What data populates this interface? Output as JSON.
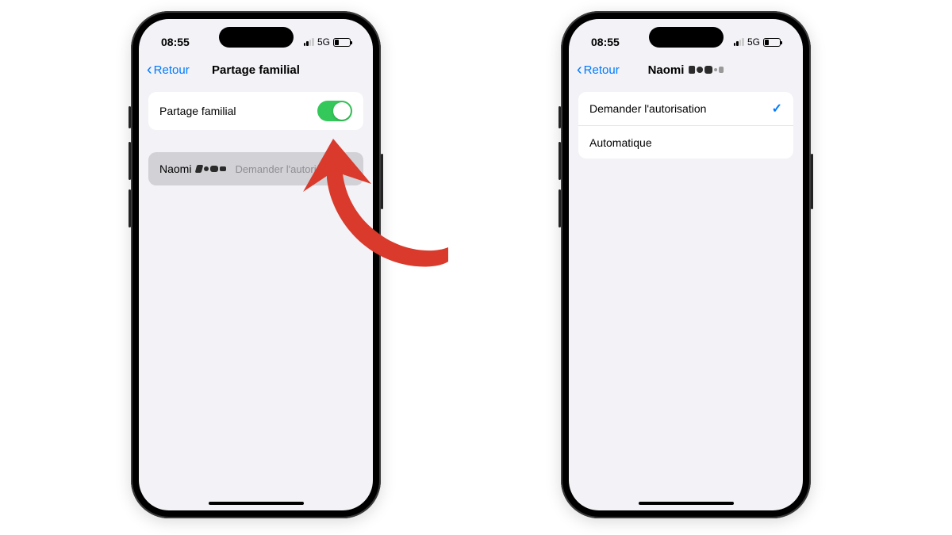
{
  "status": {
    "time": "08:55",
    "network": "5G"
  },
  "colors": {
    "ios_blue": "#007aff",
    "ios_green": "#34c759",
    "arrow_red": "#d93a2b"
  },
  "left_phone": {
    "nav": {
      "back_label": "Retour",
      "title": "Partage familial"
    },
    "toggle_row": {
      "label": "Partage familial",
      "enabled": true
    },
    "member_row": {
      "name": "Naomi",
      "name_obscured": true,
      "detail": "Demander l'autorisation"
    }
  },
  "right_phone": {
    "nav": {
      "back_label": "Retour",
      "title_prefix": "Naomi",
      "title_obscured": true
    },
    "options": [
      {
        "label": "Demander l'autorisation",
        "selected": true
      },
      {
        "label": "Automatique",
        "selected": false
      }
    ]
  }
}
